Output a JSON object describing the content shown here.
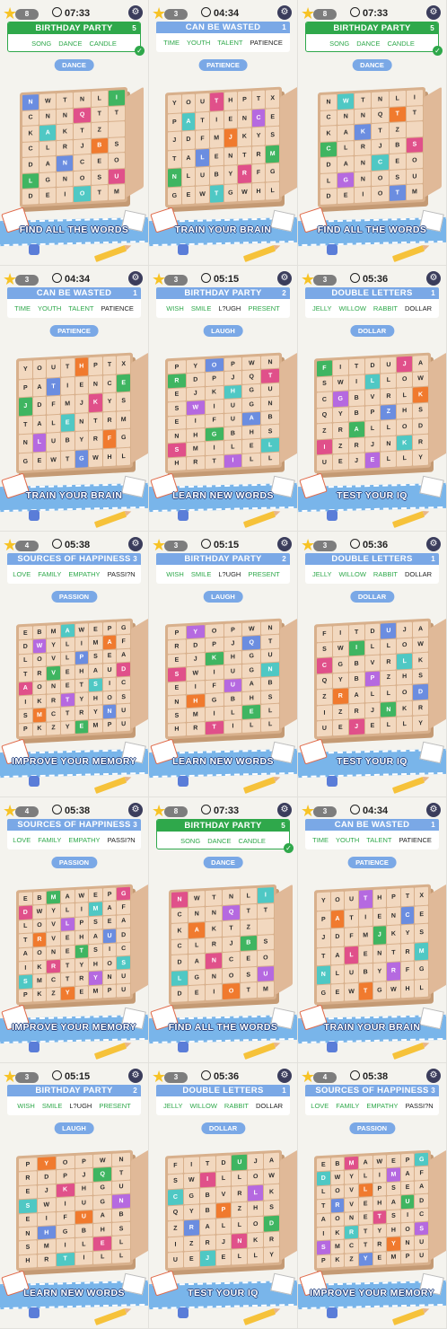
{
  "colors": {
    "accent": "#7aa8e6",
    "found": "#2fa84b",
    "banner": "#79b5ea"
  },
  "panels": [
    {
      "level": "8",
      "time": "07:33",
      "category": "BIRTHDAY PARTY",
      "count": "5",
      "done": true,
      "words": [
        "SONG",
        "DANCE",
        "CANDLE"
      ],
      "active": "",
      "pill": "DANCE",
      "banner": "FIND ALL THE WORDS",
      "cube": true,
      "rows": [
        "NWTNLI",
        "CNNQTT",
        "KAKTZ",
        "CLRJBS",
        "DANCEO",
        "LGNOSU",
        "DEIOTM"
      ]
    },
    {
      "level": "3",
      "time": "04:34",
      "category": "CAN BE WASTED",
      "count": "1",
      "done": false,
      "words": [
        "TIME",
        "YOUTH",
        "TALENT",
        "PATIENCE"
      ],
      "active": "PATIENCE",
      "pill": "PATIENCE",
      "banner": "TRAIN YOUR BRAIN",
      "cube": false,
      "rows": [
        "YOUTHPTX",
        "PATIENCE",
        "JDFMJKYS",
        "TALENTRM",
        "NLUBYRFG",
        "GEWTGWHL"
      ]
    },
    {
      "level": "8",
      "time": "07:33",
      "category": "BIRTHDAY PARTY",
      "count": "5",
      "done": true,
      "words": [
        "SONG",
        "DANCE",
        "CANDLE"
      ],
      "active": "",
      "pill": "DANCE",
      "banner": "FIND ALL THE WORDS",
      "cube": true,
      "rows": [
        "NWTNLI",
        "CNNQTT",
        "KAKTZ",
        "CLRJBS",
        "DANCEO",
        "LGNOSU",
        "DEIOTM"
      ]
    },
    {
      "level": "3",
      "time": "04:34",
      "category": "CAN BE WASTED",
      "count": "1",
      "done": false,
      "words": [
        "TIME",
        "YOUTH",
        "TALENT",
        "PATIENCE"
      ],
      "active": "PATIENCE",
      "pill": "PATIENCE",
      "banner": "TRAIN YOUR BRAIN",
      "cube": false,
      "rows": [
        "YOUTHPTX",
        "PATIENCE",
        "JDFMJKYS",
        "TALENTRM",
        "NLUBYRFG",
        "GEWTGWHL"
      ]
    },
    {
      "level": "3",
      "time": "05:15",
      "category": "BIRTHDAY PARTY",
      "count": "2",
      "done": false,
      "words": [
        "WISH",
        "SMILE",
        "L?UGH",
        "PRESENT"
      ],
      "active": "L?UGH",
      "pill": "LAUGH",
      "banner": "LEARN NEW WORDS",
      "cube": false,
      "rows": [
        "PYOPWN",
        "RDPJQT",
        "EJKHGU",
        "SWIUGN",
        "EIFUAB",
        "NHGBHS",
        "SMILEL",
        "HRTILL"
      ]
    },
    {
      "level": "3",
      "time": "05:36",
      "category": "DOUBLE LETTERS",
      "count": "1",
      "done": false,
      "words": [
        "JELLY",
        "WILLOW",
        "RABBIT",
        "DOLLAR"
      ],
      "active": "DOLLAR",
      "pill": "DOLLAR",
      "banner": "TEST YOUR IQ",
      "cube": false,
      "rows": [
        "FITDUJA",
        "SWILLOW",
        "CGBVRLK",
        "QYBPZHS",
        "ZRALLOD",
        "IZRJNKR",
        "UEJELLY"
      ]
    },
    {
      "level": "4",
      "time": "05:38",
      "category": "SOURCES OF HAPPINESS",
      "count": "3",
      "done": false,
      "words": [
        "LOVE",
        "FAMILY",
        "EMPATHY",
        "PASSI?N"
      ],
      "active": "PASSI?N",
      "pill": "PASSION",
      "banner": "IMPROVE YOUR MEMORY",
      "cube": false,
      "rows": [
        "EBMAWEPG",
        "DWYLIMAF",
        "LOVLPSEA",
        "TRVEHAUD",
        "AONETSIC",
        "IKRTYHOS",
        "SMCTRYNU",
        "PKZYEMPU"
      ]
    },
    {
      "level": "3",
      "time": "05:15",
      "category": "BIRTHDAY PARTY",
      "count": "2",
      "done": false,
      "words": [
        "WISH",
        "SMILE",
        "L?UGH",
        "PRESENT"
      ],
      "active": "L?UGH",
      "pill": "LAUGH",
      "banner": "LEARN NEW WORDS",
      "cube": false,
      "rows": [
        "PYOPWN",
        "RDPJQT",
        "EJKHGU",
        "SWIUGN",
        "EIFUAB",
        "NHGBHS",
        "SMILEL",
        "HRTILL"
      ]
    },
    {
      "level": "3",
      "time": "05:36",
      "category": "DOUBLE LETTERS",
      "count": "1",
      "done": false,
      "words": [
        "JELLY",
        "WILLOW",
        "RABBIT",
        "DOLLAR"
      ],
      "active": "DOLLAR",
      "pill": "DOLLAR",
      "banner": "TEST YOUR IQ",
      "cube": false,
      "rows": [
        "FITDUJA",
        "SWILLOW",
        "CGBVRLK",
        "QYBPZHS",
        "ZRALLOD",
        "IZRJNKR",
        "UEJELLY"
      ]
    },
    {
      "level": "4",
      "time": "05:38",
      "category": "SOURCES OF HAPPINESS",
      "count": "3",
      "done": false,
      "words": [
        "LOVE",
        "FAMILY",
        "EMPATHY",
        "PASSI?N"
      ],
      "active": "PASSI?N",
      "pill": "PASSION",
      "banner": "IMPROVE YOUR MEMORY",
      "cube": false,
      "rows": [
        "EBMAWEPG",
        "DWYLIMAF",
        "LOVLPSEA",
        "TRVEHAUD",
        "AONETSIC",
        "IKRTYHOS",
        "SMCTRYNU",
        "PKZYEMPU"
      ]
    },
    {
      "level": "8",
      "time": "07:33",
      "category": "BIRTHDAY PARTY",
      "count": "5",
      "done": true,
      "words": [
        "SONG",
        "DANCE",
        "CANDLE"
      ],
      "active": "",
      "pill": "DANCE",
      "banner": "FIND ALL THE WORDS",
      "cube": true,
      "rows": [
        "NWTNLI",
        "CNNQTT",
        "KAKTZ",
        "CLRJBS",
        "DANCEO",
        "LGNOSU",
        "DEIOTM"
      ]
    },
    {
      "level": "3",
      "time": "04:34",
      "category": "CAN BE WASTED",
      "count": "1",
      "done": false,
      "words": [
        "TIME",
        "YOUTH",
        "TALENT",
        "PATIENCE"
      ],
      "active": "PATIENCE",
      "pill": "PATIENCE",
      "banner": "TRAIN YOUR BRAIN",
      "cube": false,
      "rows": [
        "YOUTHPTX",
        "PATIENCE",
        "JDFMJKYS",
        "TALENTRM",
        "NLUBYRFG",
        "GEWTGWHL"
      ]
    },
    {
      "level": "3",
      "time": "05:15",
      "category": "BIRTHDAY PARTY",
      "count": "2",
      "done": false,
      "words": [
        "WISH",
        "SMILE",
        "L?UGH",
        "PRESENT"
      ],
      "active": "L?UGH",
      "pill": "LAUGH",
      "banner": "LEARN NEW WORDS",
      "cube": false,
      "rows": [
        "PYOPWN",
        "RDPJQT",
        "EJKHGU",
        "SWIUGN",
        "EIFUAB",
        "NHGBHS",
        "SMILEL",
        "HRTILL"
      ]
    },
    {
      "level": "3",
      "time": "05:36",
      "category": "DOUBLE LETTERS",
      "count": "1",
      "done": false,
      "words": [
        "JELLY",
        "WILLOW",
        "RABBIT",
        "DOLLAR"
      ],
      "active": "DOLLAR",
      "pill": "DOLLAR",
      "banner": "TEST YOUR IQ",
      "cube": false,
      "rows": [
        "FITDUJA",
        "SWILLOW",
        "CGBVRLK",
        "QYBPZHS",
        "ZRALLOD",
        "IZRJNKR",
        "UEJELLY"
      ]
    },
    {
      "level": "4",
      "time": "05:38",
      "category": "SOURCES OF HAPPINESS",
      "count": "3",
      "done": false,
      "words": [
        "LOVE",
        "FAMILY",
        "EMPATHY",
        "PASSI?N"
      ],
      "active": "PASSI?N",
      "pill": "PASSION",
      "banner": "IMPROVE YOUR MEMORY",
      "cube": false,
      "rows": [
        "EBMAWEPG",
        "DWYLIMAF",
        "LOVLPSEA",
        "TRVEHAUD",
        "AONETSIC",
        "IKRTYHOS",
        "SMCTRYNU",
        "PKZYEMPU"
      ]
    }
  ]
}
